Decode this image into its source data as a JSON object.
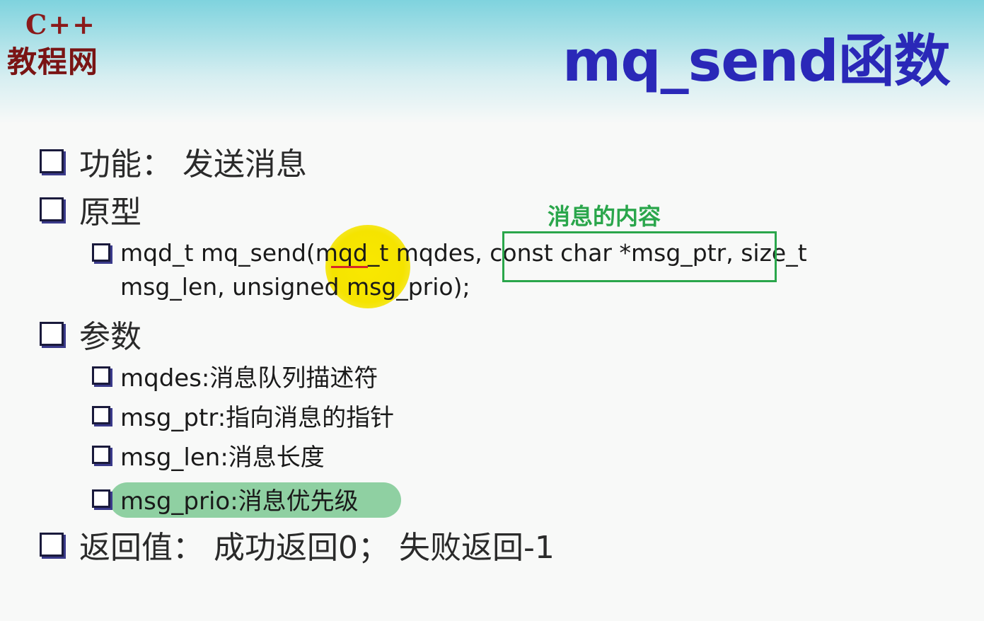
{
  "logo": {
    "line1": "C++",
    "line2": "教程网"
  },
  "title": "mq_send函数",
  "annotation": "消息的内容",
  "items": {
    "function": "功能：  发送消息",
    "prototype_heading": "原型",
    "prototype_line1": "mqd_t mq_send(mqd_t mqdes, const char *msg_ptr, size_t",
    "prototype_line2": "msg_len, unsigned msg_prio);",
    "params_heading": "参数",
    "params": [
      "mqdes:消息队列描述符",
      "msg_ptr:指向消息的指针",
      "msg_len:消息长度",
      "msg_prio:消息优先级"
    ],
    "return_value": "返回值：  成功返回0；  失败返回-1"
  },
  "colors": {
    "title": "#2a28b8",
    "logo": "#7a1414",
    "annotation_green": "#2aa64b",
    "highlight_yellow": "#f5e400",
    "pill_green": "#8fd0a2",
    "underline_red": "#d82828"
  }
}
